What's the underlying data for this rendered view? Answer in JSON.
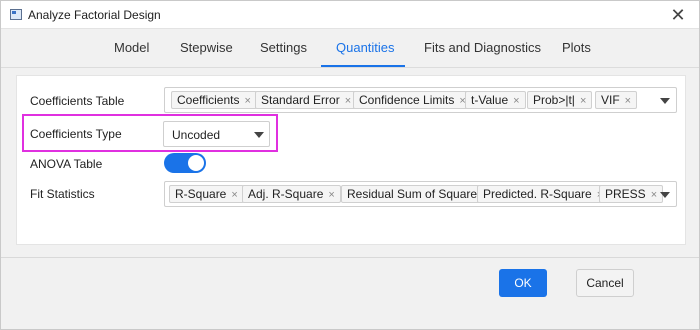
{
  "window": {
    "title": "Analyze Factorial Design",
    "close_glyph": "✕"
  },
  "tabs": [
    {
      "label": "Model"
    },
    {
      "label": "Stepwise"
    },
    {
      "label": "Settings"
    },
    {
      "label": "Quantities"
    },
    {
      "label": "Fits and Diagnostics"
    },
    {
      "label": "Plots"
    }
  ],
  "active_tab": "Quantities",
  "quantities": {
    "coefficients_table": {
      "label": "Coefficients Table",
      "chips": [
        "Coefficients",
        "Standard Error",
        "Confidence Limits",
        "t-Value",
        "Prob>|t|",
        "VIF"
      ]
    },
    "coefficients_type": {
      "label": "Coefficients Type",
      "value": "Uncoded"
    },
    "anova_table": {
      "label": "ANOVA Table",
      "enabled": true
    },
    "fit_statistics": {
      "label": "Fit Statistics",
      "chips": [
        "R-Square",
        "Adj. R-Square",
        "Residual Sum of Square",
        "Predicted. R-Square",
        "PRESS"
      ]
    }
  },
  "footer": {
    "ok_label": "OK",
    "cancel_label": "Cancel"
  },
  "colors": {
    "accent": "#1a73e8",
    "highlight": "#e030e0"
  },
  "chip_remove_glyph": "×"
}
